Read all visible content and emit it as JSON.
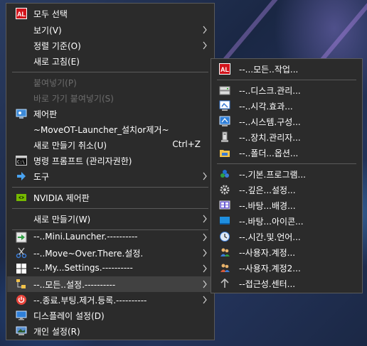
{
  "main_menu": {
    "items": [
      {
        "label": "모두 선택",
        "icon": "app-logo-icon"
      },
      {
        "label": "보기(V)",
        "submenu": true
      },
      {
        "label": "정렬 기준(O)",
        "submenu": true
      },
      {
        "label": "새로 고침(E)"
      },
      {
        "label": "붙여넣기(P)",
        "disabled": true
      },
      {
        "label": "바로 가기 붙여넣기(S)",
        "disabled": true
      },
      {
        "label": "제어판",
        "icon": "control-panel-icon"
      },
      {
        "label": "~MoveOT-Launcher_설치or제거~"
      },
      {
        "label": "새로 만들기 취소(U)",
        "shortcut": "Ctrl+Z"
      },
      {
        "label": "명령 프롬프트 (관리자권한)",
        "icon": "command-prompt-icon"
      },
      {
        "label": "도구",
        "icon": "arrow-icon",
        "submenu": true
      },
      {
        "label": "NVIDIA 제어판",
        "icon": "nvidia-icon"
      },
      {
        "label": "새로 만들기(W)",
        "submenu": true
      },
      {
        "label": "--..Mini.Launcher.----------",
        "icon": "green-arrow-icon",
        "submenu": true
      },
      {
        "label": "--..Move~Over.There.설정.",
        "icon": "scissors-icon",
        "submenu": true
      },
      {
        "label": "--..My...Settings.----------",
        "icon": "windows-icon",
        "submenu": true
      },
      {
        "label": "--..모든..설정.----------",
        "icon": "folder-tree-icon",
        "submenu": true
      },
      {
        "label": "--.종료.부팅.제거.등록.----------",
        "icon": "power-icon",
        "submenu": true
      },
      {
        "label": "디스플레이 설정(D)",
        "icon": "display-icon"
      },
      {
        "label": "개인 설정(R)",
        "icon": "personalize-icon"
      }
    ]
  },
  "sub_menu": {
    "items": [
      {
        "label": "--...모든..작업...",
        "icon": "app-logo-icon"
      },
      {
        "label": "--..디스크.관리...",
        "icon": "disk-management-icon"
      },
      {
        "label": "--..시각.효과...",
        "icon": "visual-effects-icon"
      },
      {
        "label": "--..시스템.구성...",
        "icon": "system-config-icon"
      },
      {
        "label": "--..장치.관리자...",
        "icon": "device-manager-icon"
      },
      {
        "label": "--..폴더...옵션...",
        "icon": "folder-options-icon"
      },
      {
        "label": "--.기본.프로그램...",
        "icon": "default-programs-icon"
      },
      {
        "label": "--.깊은...설정...",
        "icon": "deep-settings-icon"
      },
      {
        "label": "--.바탕...배경...",
        "icon": "wallpaper-icon"
      },
      {
        "label": "--.바탕...아이콘...",
        "icon": "desktop-icons-icon"
      },
      {
        "label": "--.시간.및.언어...",
        "icon": "time-language-icon"
      },
      {
        "label": "--사용자.계정...",
        "icon": "user-accounts-icon"
      },
      {
        "label": "--사용자.계정2...",
        "icon": "user-accounts-2-icon"
      },
      {
        "label": "--접근성.센터...",
        "icon": "accessibility-icon"
      }
    ]
  },
  "colors": {
    "menu_bg": "#2b2b2b",
    "highlight": "#414141",
    "separator": "#5a5a5a",
    "disabled_text": "#6d6d6d",
    "logo_red": "#d2141c"
  }
}
